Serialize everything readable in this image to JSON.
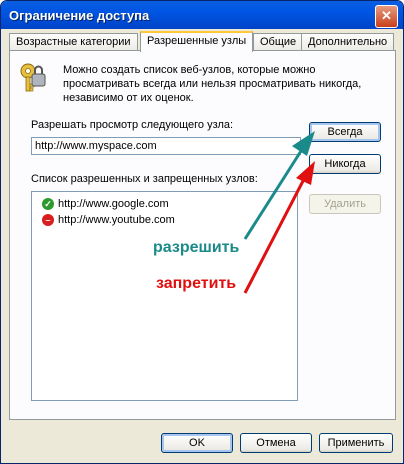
{
  "window": {
    "title": "Ограничение доступа",
    "close_glyph": "✕"
  },
  "tabs": [
    {
      "label": "Возрастные категории",
      "active": false
    },
    {
      "label": "Разрешенные узлы",
      "active": true
    },
    {
      "label": "Общие",
      "active": false
    },
    {
      "label": "Дополнительно",
      "active": false
    }
  ],
  "panel": {
    "icon": "keys-icon",
    "description": "Можно создать список веб-узлов, которые можно просматривать всегда или нельзя просматривать никогда, независимо от их оценок.",
    "url_label": "Разрешать просмотр следующего узла:",
    "url_value": "http://www.myspace.com",
    "list_label": "Список разрешенных и запрещенных узлов:",
    "sites": [
      {
        "url": "http://www.google.com",
        "status": "allow",
        "icon": "allow-check-icon"
      },
      {
        "url": "http://www.youtube.com",
        "status": "deny",
        "icon": "deny-block-icon"
      }
    ],
    "buttons": {
      "always": "Всегда",
      "never": "Никогда",
      "delete": "Удалить"
    }
  },
  "annotations": {
    "allow": {
      "text": "разрешить",
      "color": "#1a8a8a"
    },
    "deny": {
      "text": "запретить",
      "color": "#e01010"
    }
  },
  "dialog_buttons": {
    "ok": "OK",
    "cancel": "Отмена",
    "apply": "Применить"
  }
}
